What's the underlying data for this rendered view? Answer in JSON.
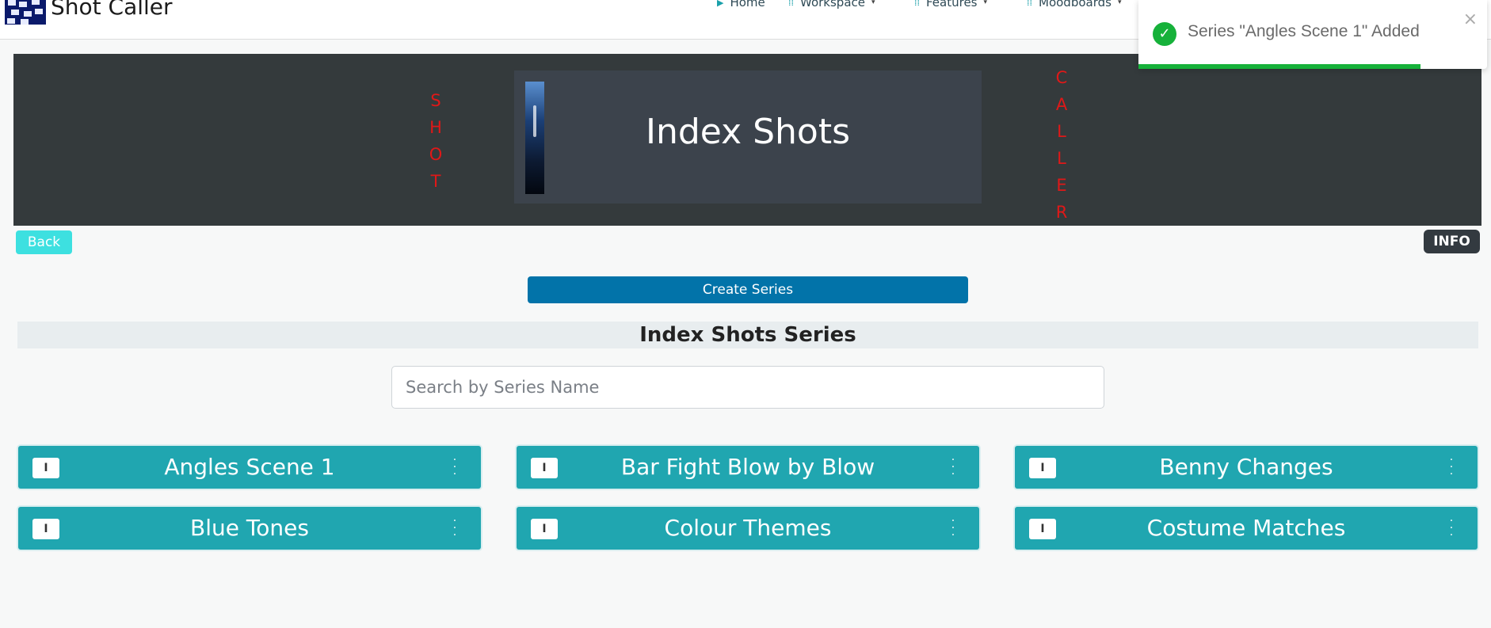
{
  "app": {
    "title": "Shot Caller"
  },
  "nav": {
    "items": [
      {
        "label": "Home",
        "icon": "play-icon",
        "has_caret": false
      },
      {
        "label": "Workspace",
        "icon": "grip-icon",
        "has_caret": true
      },
      {
        "label": "Features",
        "icon": "grip-icon",
        "has_caret": true
      },
      {
        "label": "Moodboards",
        "icon": "grip-icon",
        "has_caret": true
      }
    ]
  },
  "toast": {
    "message": "Series \"Angles Scene 1\" Added",
    "close_glyph": "×",
    "progress_fraction": 0.81,
    "color": "#16b13a"
  },
  "banner": {
    "title": "Index Shots",
    "left_vertical": [
      "S",
      "H",
      "O",
      "T"
    ],
    "right_vertical": [
      "C",
      "A",
      "L",
      "L",
      "E",
      "R"
    ],
    "vertical_color": "#e01818"
  },
  "buttons": {
    "back": "Back",
    "info": "INFO",
    "create": "Create Series"
  },
  "section": {
    "title": "Index Shots Series"
  },
  "search": {
    "placeholder": "Search by Series Name",
    "value": ""
  },
  "series": [
    {
      "tag": "I",
      "title": "Angles Scene 1"
    },
    {
      "tag": "I",
      "title": "Bar Fight Blow by Blow"
    },
    {
      "tag": "I",
      "title": "Benny Changes"
    },
    {
      "tag": "I",
      "title": "Blue Tones"
    },
    {
      "tag": "I",
      "title": "Colour Themes"
    },
    {
      "tag": "I",
      "title": "Costume Matches"
    }
  ],
  "colors": {
    "card": "#20a6b0",
    "back_button": "#3de0e0",
    "create_button": "#0273a9",
    "banner": "#343a3c"
  }
}
